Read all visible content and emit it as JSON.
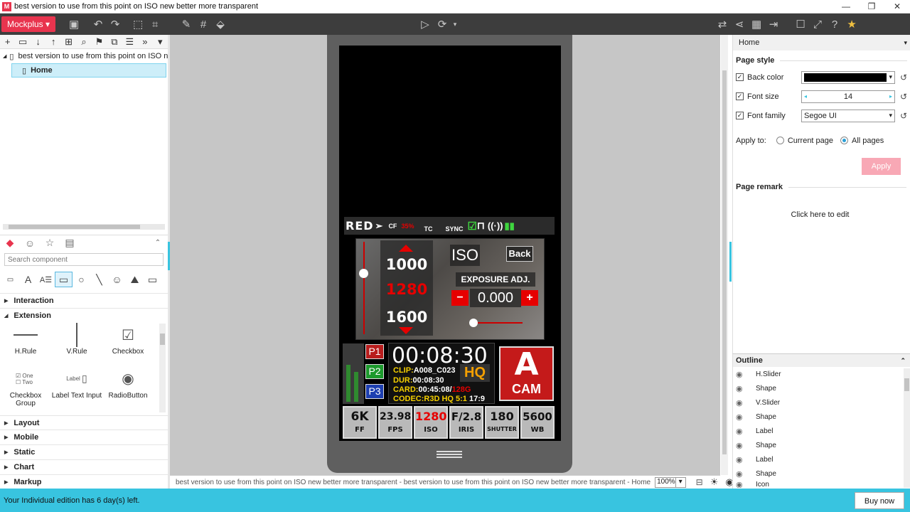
{
  "window": {
    "title": "best version to use from this point on ISO new better more transparent"
  },
  "toolbar": {
    "brand": "Mockplus"
  },
  "tree": {
    "project": "best version to use from this point on ISO new better more transparent",
    "page": "Home"
  },
  "components": {
    "search_placeholder": "Search component",
    "categories_top": [
      "Interaction",
      "Extension"
    ],
    "items": [
      "H.Rule",
      "V.Rule",
      "Checkbox",
      "Checkbox Group",
      "Label Text Input",
      "RadioButton"
    ],
    "checkbox_group_opts": [
      "One",
      "Two"
    ],
    "label_input_label": "Label",
    "categories_bottom": [
      "Layout",
      "Mobile",
      "Static",
      "Chart",
      "Markup"
    ]
  },
  "canvas": {
    "breadcrumb": "best version to use from this point on ISO new better more transparent - best version to use from this point on ISO new better more transparent - Home",
    "zoom": "100%"
  },
  "phone": {
    "top": {
      "brand": "RED",
      "cf": "CF",
      "cf_pct": "35%",
      "tc": "TC",
      "sync": "SYNC"
    },
    "iso": {
      "up_val": "1000",
      "sel_val": "1280",
      "down_val": "1600",
      "label": "ISO",
      "back": "Back",
      "exposure": "EXPOSURE ADJ.",
      "exposure_val": "0.000",
      "minus": "−",
      "plus": "+"
    },
    "presets": [
      "P1",
      "P2",
      "P3"
    ],
    "timecode": "00:08:30",
    "clip_label": "CLIP:",
    "clip_val": "A008_C023",
    "dur_label": "DUR:",
    "dur_val": "00:08:30",
    "card_label": "CARD:",
    "card_val": "00:45:08/",
    "card_cap": "128G",
    "codec_label": "CODEC:",
    "codec_val": "R3D HQ 5:1",
    "aspect": "17:9",
    "hq": "HQ",
    "cam_letter": "A",
    "cam_label": "CAM",
    "tiles": [
      {
        "v": "6K",
        "l": "FF"
      },
      {
        "v": "23.98",
        "l": "FPS"
      },
      {
        "v": "1280",
        "l": "ISO"
      },
      {
        "v": "F/2.8",
        "l": "IRIS"
      },
      {
        "v": "180",
        "l": "SHUTTER"
      },
      {
        "v": "5600",
        "l": "WB"
      }
    ]
  },
  "right": {
    "header": "Home",
    "page_style": "Page style",
    "back_color_label": "Back color",
    "font_size_label": "Font size",
    "font_size": "14",
    "font_family_label": "Font family",
    "font_family": "Segoe UI",
    "apply_to": "Apply to:",
    "current_page": "Current page",
    "all_pages": "All pages",
    "apply": "Apply",
    "page_remark": "Page remark",
    "remark_hint": "Click here to edit",
    "outline": "Outline",
    "outline_items": [
      "H.Slider",
      "Shape",
      "V.Slider",
      "Shape",
      "Label",
      "Shape",
      "Label",
      "Shape",
      "Icon"
    ]
  },
  "status": {
    "msg": "Your Individual edition has 6 day(s) left.",
    "buy": "Buy now"
  },
  "colors": {
    "accent": "#e8344e",
    "status": "#38c4e0",
    "red": "#e60000"
  }
}
